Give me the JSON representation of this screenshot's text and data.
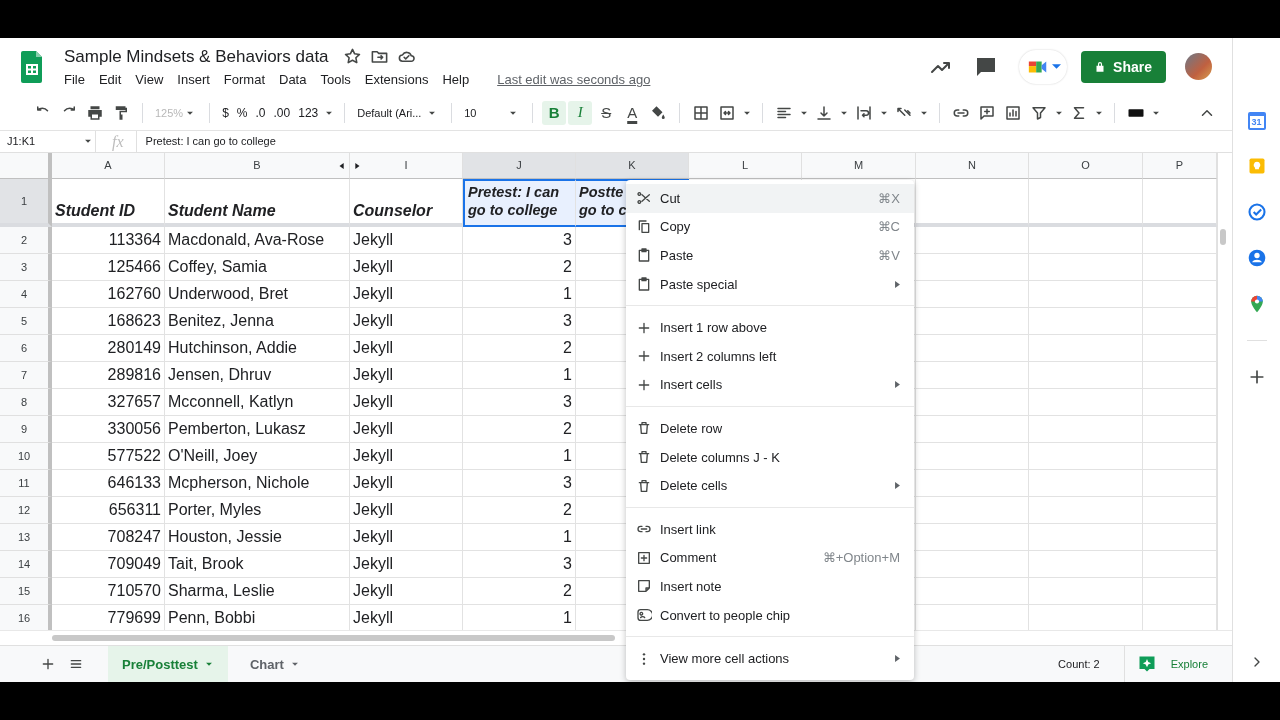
{
  "document": {
    "title": "Sample Mindsets & Behaviors data",
    "menus": [
      "File",
      "Edit",
      "View",
      "Insert",
      "Format",
      "Data",
      "Tools",
      "Extensions",
      "Help"
    ],
    "last_edit": "Last edit was seconds ago"
  },
  "share_button": "Share",
  "toolbar": {
    "zoom": {
      "label": "125%",
      "disabled": true
    },
    "format_buttons": [
      "$",
      "%",
      ".0",
      ".00",
      "123"
    ],
    "font": "Default (Ari...",
    "font_size": "10",
    "style_buttons": [
      {
        "label": "B",
        "selected": true
      },
      {
        "label": "I",
        "selected": true
      },
      {
        "label": "S",
        "selected": false
      },
      {
        "label": "A",
        "selected": false
      }
    ]
  },
  "formula_bar": {
    "name_box": "J1:K1",
    "fx": "fx",
    "value": "Pretest: I can go to college"
  },
  "columns": [
    {
      "label": "A",
      "selected": false
    },
    {
      "label": "B",
      "selected": false
    },
    {
      "label": "I",
      "selected": false
    },
    {
      "label": "J",
      "selected": true
    },
    {
      "label": "K",
      "selected": true
    },
    {
      "label": "L",
      "selected": false
    },
    {
      "label": "M",
      "selected": false
    },
    {
      "label": "N",
      "selected": false
    },
    {
      "label": "O",
      "selected": false
    },
    {
      "label": "P",
      "selected": false
    }
  ],
  "header_row": {
    "number": "1",
    "selected": true,
    "cells": [
      "Student ID",
      "Student Name",
      "Counselor",
      "Pretest: I can go to college",
      "Postte\ngo to c"
    ]
  },
  "rows": [
    {
      "number": "2",
      "cells": [
        "113364",
        "Macdonald, Ava-Rose",
        "Jekyll",
        "3"
      ]
    },
    {
      "number": "3",
      "cells": [
        "125466",
        "Coffey, Samia",
        "Jekyll",
        "2"
      ]
    },
    {
      "number": "4",
      "cells": [
        "162760",
        "Underwood, Bret",
        "Jekyll",
        "1"
      ]
    },
    {
      "number": "5",
      "cells": [
        "168623",
        "Benitez, Jenna",
        "Jekyll",
        "3"
      ]
    },
    {
      "number": "6",
      "cells": [
        "280149",
        "Hutchinson, Addie",
        "Jekyll",
        "2"
      ]
    },
    {
      "number": "7",
      "cells": [
        "289816",
        "Jensen, Dhruv",
        "Jekyll",
        "1"
      ]
    },
    {
      "number": "8",
      "cells": [
        "327657",
        "Mcconnell, Katlyn",
        "Jekyll",
        "3"
      ]
    },
    {
      "number": "9",
      "cells": [
        "330056",
        "Pemberton, Lukasz",
        "Jekyll",
        "2"
      ]
    },
    {
      "number": "10",
      "cells": [
        "577522",
        "O'Neill, Joey",
        "Jekyll",
        "1"
      ]
    },
    {
      "number": "11",
      "cells": [
        "646133",
        "Mcpherson, Nichole",
        "Jekyll",
        "3"
      ]
    },
    {
      "number": "12",
      "cells": [
        "656311",
        "Porter, Myles",
        "Jekyll",
        "2"
      ]
    },
    {
      "number": "13",
      "cells": [
        "708247",
        "Houston, Jessie",
        "Jekyll",
        "1"
      ]
    },
    {
      "number": "14",
      "cells": [
        "709049",
        "Tait, Brook",
        "Jekyll",
        "3"
      ]
    },
    {
      "number": "15",
      "cells": [
        "710570",
        "Sharma, Leslie",
        "Jekyll",
        "2"
      ]
    },
    {
      "number": "16",
      "cells": [
        "779699",
        "Penn, Bobbi",
        "Jekyll",
        "1"
      ]
    }
  ],
  "context_menu": [
    [
      {
        "label": "Cut",
        "shortcut": "⌘X",
        "submenu": false,
        "highlighted": true
      },
      {
        "label": "Copy",
        "shortcut": "⌘C",
        "submenu": false,
        "highlighted": false
      },
      {
        "label": "Paste",
        "shortcut": "⌘V",
        "submenu": false,
        "highlighted": false
      },
      {
        "label": "Paste special",
        "submenu": true,
        "highlighted": false
      }
    ],
    [
      {
        "label": "Insert 1 row above",
        "submenu": false,
        "highlighted": false
      },
      {
        "label": "Insert 2 columns left",
        "submenu": false,
        "highlighted": false
      },
      {
        "label": "Insert cells",
        "submenu": true,
        "highlighted": false
      }
    ],
    [
      {
        "label": "Delete row",
        "submenu": false,
        "highlighted": false
      },
      {
        "label": "Delete columns J - K",
        "submenu": false,
        "highlighted": false
      },
      {
        "label": "Delete cells",
        "submenu": true,
        "highlighted": false
      }
    ],
    [
      {
        "label": "Insert link",
        "submenu": false,
        "highlighted": false
      },
      {
        "label": "Comment",
        "shortcut": "⌘+Option+M",
        "submenu": false,
        "highlighted": false
      },
      {
        "label": "Insert note",
        "submenu": false,
        "highlighted": false
      },
      {
        "label": "Convert to people chip",
        "submenu": false,
        "highlighted": false
      }
    ],
    [
      {
        "label": "View more cell actions",
        "submenu": true,
        "highlighted": false
      }
    ]
  ],
  "sheet_tabs": [
    {
      "label": "Pre/Posttest",
      "selected": true
    },
    {
      "label": "Chart",
      "selected": false
    }
  ],
  "status": {
    "count": "Count: 2",
    "explore": "Explore"
  },
  "side_panel": {
    "calendar_day": "31"
  }
}
